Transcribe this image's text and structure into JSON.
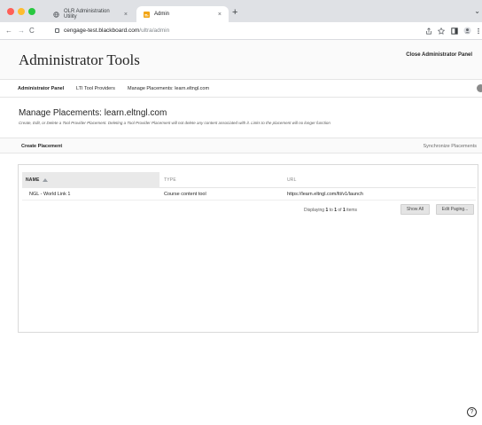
{
  "browser": {
    "tabs": [
      {
        "label": "OLR Administration Utility",
        "close": "×"
      },
      {
        "label": "Admin",
        "close": "×"
      }
    ],
    "new_tab": "+",
    "tab_menu": "⌄",
    "nav": {
      "back": "←",
      "forward": "→",
      "reload": "C"
    },
    "url": {
      "host": "cengage-test.blackboard.com",
      "path": "/ultra/admin"
    },
    "toolbar_icons": [
      "share-icon",
      "star-icon",
      "sidebar-icon",
      "profile-icon",
      "menu-icon"
    ]
  },
  "header": {
    "title": "Administrator Tools",
    "close_panel": "Close Administrator Panel"
  },
  "breadcrumb": {
    "items": [
      "Administrator Panel",
      "LTI Tool Providers",
      "Manage Placements: learn.eltngl.com"
    ]
  },
  "section": {
    "title": "Manage Placements: learn.eltngl.com",
    "description": "Create, Edit, or Delete a Tool Provider Placement. Deleting a Tool Provider Placement will not delete any content associated with it. Links to the placement will no longer function"
  },
  "actions": {
    "create": "Create Placement",
    "sync": "Synchronize Placements"
  },
  "table": {
    "columns": [
      "NAME",
      "TYPE",
      "URL"
    ],
    "rows": [
      {
        "name": "NGL - World Link 1",
        "type": "Course content tool",
        "url": "https://learn.eltngl.com/lti/v1/launch"
      }
    ]
  },
  "pager": {
    "prefix": "Displaying",
    "from": "1",
    "to_word": "to",
    "to": "1",
    "of_word": "of",
    "total": "1",
    "suffix": "items",
    "show_all": "Show All",
    "edit_paging": "Edit Paging..."
  },
  "help": "?",
  "colors": {
    "tabbar": "#dfe1e5",
    "traffic_red": "#ff5f57",
    "traffic_yellow": "#febc2e",
    "traffic_green": "#28c840",
    "admin_favicon": "#f2a516"
  }
}
